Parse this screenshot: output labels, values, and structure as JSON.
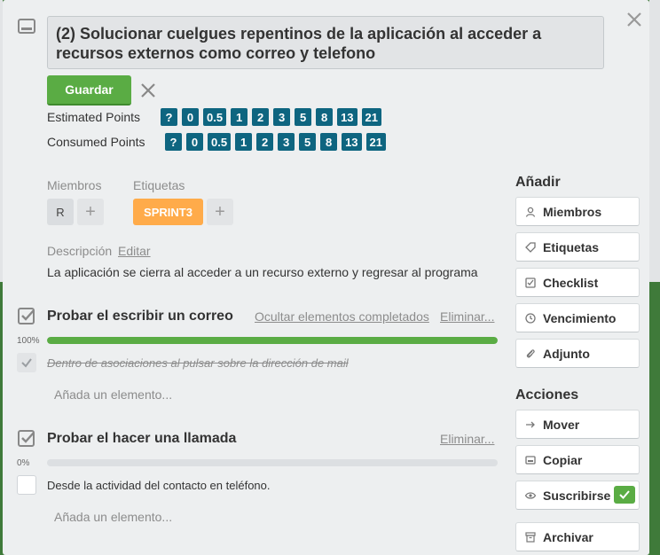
{
  "card": {
    "title": "(2) Solucionar cuelgues repentinos de la aplicación al acceder a recursos externos como correo y telefono",
    "save_label": "Guardar"
  },
  "points": {
    "estimated_label": "Estimated Points",
    "consumed_label": "Consumed Points",
    "values": [
      "?",
      "0",
      "0.5",
      "1",
      "2",
      "3",
      "5",
      "8",
      "13",
      "21"
    ]
  },
  "members": {
    "label": "Miembros",
    "initial": "R",
    "add": "+"
  },
  "labels": {
    "label": "Etiquetas",
    "items": [
      "SPRINT3"
    ],
    "add": "+"
  },
  "description": {
    "label": "Descripción",
    "edit": "Editar",
    "text": "La aplicación se cierra al acceder a un recurso externo y regresar al programa"
  },
  "checklists": [
    {
      "title": "Probar el escribir un correo",
      "hide_label": "Ocultar elementos completados",
      "delete_label": "Eliminar...",
      "percent": "100%",
      "progress": 1.0,
      "items": [
        {
          "text": "Dentro de asociaciones al pulsar sobre la dirección de mail",
          "done": true
        }
      ],
      "add_placeholder": "Añada un elemento..."
    },
    {
      "title": "Probar el hacer una llamada",
      "delete_label": "Eliminar...",
      "percent": "0%",
      "progress": 0.0,
      "items": [
        {
          "text": "Desde la actividad del contacto en teléfono.",
          "done": false
        }
      ],
      "add_placeholder": "Añada un elemento..."
    }
  ],
  "sidebar": {
    "add_heading": "Añadir",
    "add_buttons": [
      {
        "label": "Miembros",
        "icon": "person-icon"
      },
      {
        "label": "Etiquetas",
        "icon": "tag-icon"
      },
      {
        "label": "Checklist",
        "icon": "checkbox-icon"
      },
      {
        "label": "Vencimiento",
        "icon": "clock-icon"
      },
      {
        "label": "Adjunto",
        "icon": "paperclip-icon"
      }
    ],
    "actions_heading": "Acciones",
    "action_buttons": [
      {
        "label": "Mover",
        "icon": "arrow-right-icon"
      },
      {
        "label": "Copiar",
        "icon": "card-icon"
      },
      {
        "label": "Suscribirse",
        "icon": "eye-icon",
        "active": true
      },
      {
        "label": "Archivar",
        "icon": "archive-icon"
      }
    ]
  },
  "colors": {
    "accent_green": "#5aac44",
    "point_chip": "#0e6580",
    "label_orange": "#ffab4a"
  }
}
